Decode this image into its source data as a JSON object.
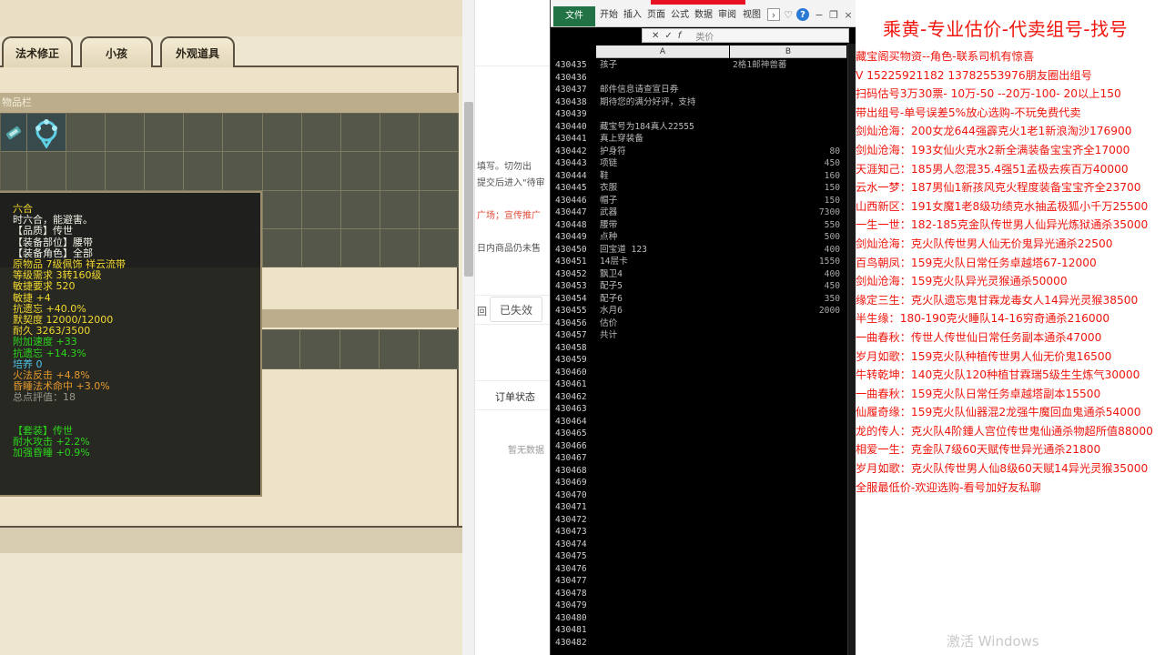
{
  "game": {
    "tabs": [
      "法术修正",
      "小孩",
      "外观道具"
    ],
    "inventory_header": "物品栏",
    "tooltip": {
      "name": "六合",
      "desc": "时六合，能避害。",
      "quality": "【品质】传世",
      "slot": "【装备部位】腰带",
      "role": "【装备角色】全部",
      "origin": "原物品 7级佩饰 祥云流带",
      "level_req": "等级需求 3转160级",
      "agi_req": "敏捷要求 520",
      "agi": "敏捷 +4",
      "resist_forget": "抗遗忘 +40.0%",
      "tacit": "默契度 12000/12000",
      "durability": "耐久 3263/3500",
      "speed": "附加速度 +33",
      "resist_forget2": "抗遗忘 +14.3%",
      "cultivate": "培养 0",
      "fire_counter": "火法反击 +4.8%",
      "sleep_hit": "昏睡法术命中 +3.0%",
      "total": "总点評值：18",
      "set": "【套装】传世",
      "water_atk": "耐水攻击 +2.2%",
      "sleep_boost": "加强昏睡 +0.9%"
    }
  },
  "web": {
    "text1": "填写。切勿出",
    "text2": "提交后进入\"待审",
    "text3": "广场；宣传推广",
    "text4": "日内商品仍未售",
    "col_left": "回",
    "expired_btn": "已失效",
    "order_status": "订单状态",
    "no_data": "暂无数据"
  },
  "excel": {
    "tabs": [
      "文件",
      "开始",
      "插入",
      "页面",
      "公式",
      "数据",
      "审阅",
      "视图"
    ],
    "formula_bar": "类价",
    "col_a": "A",
    "col_b": "B",
    "rows": [
      {
        "num": "430435",
        "a": "孩子",
        "b": "2格1邮神兽蕃",
        "v": ""
      },
      {
        "num": "430436",
        "a": "",
        "b": "",
        "v": ""
      },
      {
        "num": "430437",
        "a": "邮件信息请查宣日券",
        "b": "",
        "v": ""
      },
      {
        "num": "430438",
        "a": "期待您的满分好评，支持",
        "b": "",
        "v": ""
      },
      {
        "num": "430439",
        "a": "",
        "b": "",
        "v": ""
      },
      {
        "num": "430440",
        "a": "藏宝号为184真人22555",
        "b": "",
        "v": ""
      },
      {
        "num": "430441",
        "a": "真上穿装备",
        "b": "",
        "v": ""
      },
      {
        "num": "430442",
        "a": "护身符",
        "b": "",
        "v": "80"
      },
      {
        "num": "430443",
        "a": "项链",
        "b": "",
        "v": "450"
      },
      {
        "num": "430444",
        "a": "鞋",
        "b": "",
        "v": "160"
      },
      {
        "num": "430445",
        "a": "衣服",
        "b": "",
        "v": "150"
      },
      {
        "num": "430446",
        "a": "帽子",
        "b": "",
        "v": "150"
      },
      {
        "num": "430447",
        "a": "武器",
        "b": "",
        "v": "7300"
      },
      {
        "num": "430448",
        "a": "腰带",
        "b": "",
        "v": "550"
      },
      {
        "num": "430449",
        "a": "点种",
        "b": "",
        "v": "500"
      },
      {
        "num": "430450",
        "a": "回宝道 123",
        "b": "",
        "v": "400"
      },
      {
        "num": "430451",
        "a": "14层卡",
        "b": "",
        "v": "1550"
      },
      {
        "num": "430452",
        "a": "飘卫4",
        "b": "",
        "v": "400"
      },
      {
        "num": "430453",
        "a": "配子5",
        "b": "",
        "v": "450"
      },
      {
        "num": "430454",
        "a": "配子6",
        "b": "",
        "v": "350"
      },
      {
        "num": "430455",
        "a": "水月6",
        "b": "",
        "v": "2000"
      },
      {
        "num": "430456",
        "a": "估价",
        "b": "",
        "v": ""
      },
      {
        "num": "430457",
        "a": "共计",
        "b": "",
        "v": ""
      },
      {
        "num": "430458",
        "a": "",
        "b": "",
        "v": ""
      },
      {
        "num": "430459",
        "a": "",
        "b": "",
        "v": ""
      },
      {
        "num": "430460",
        "a": "",
        "b": "",
        "v": ""
      },
      {
        "num": "430461",
        "a": "",
        "b": "",
        "v": ""
      },
      {
        "num": "430462",
        "a": "",
        "b": "",
        "v": ""
      },
      {
        "num": "430463",
        "a": "",
        "b": "",
        "v": ""
      },
      {
        "num": "430464",
        "a": "",
        "b": "",
        "v": ""
      },
      {
        "num": "430465",
        "a": "",
        "b": "",
        "v": ""
      },
      {
        "num": "430466",
        "a": "",
        "b": "",
        "v": ""
      },
      {
        "num": "430467",
        "a": "",
        "b": "",
        "v": ""
      },
      {
        "num": "430468",
        "a": "",
        "b": "",
        "v": ""
      },
      {
        "num": "430469",
        "a": "",
        "b": "",
        "v": ""
      },
      {
        "num": "430470",
        "a": "",
        "b": "",
        "v": ""
      },
      {
        "num": "430471",
        "a": "",
        "b": "",
        "v": ""
      },
      {
        "num": "430472",
        "a": "",
        "b": "",
        "v": ""
      },
      {
        "num": "430473",
        "a": "",
        "b": "",
        "v": ""
      },
      {
        "num": "430474",
        "a": "",
        "b": "",
        "v": ""
      },
      {
        "num": "430475",
        "a": "",
        "b": "",
        "v": ""
      },
      {
        "num": "430476",
        "a": "",
        "b": "",
        "v": ""
      },
      {
        "num": "430477",
        "a": "",
        "b": "",
        "v": ""
      },
      {
        "num": "430478",
        "a": "",
        "b": "",
        "v": ""
      },
      {
        "num": "430479",
        "a": "",
        "b": "",
        "v": ""
      },
      {
        "num": "430480",
        "a": "",
        "b": "",
        "v": ""
      },
      {
        "num": "430481",
        "a": "",
        "b": "",
        "v": ""
      },
      {
        "num": "430482",
        "a": "",
        "b": "",
        "v": ""
      }
    ]
  },
  "ad": {
    "title": "乘黄-专业估价-代卖组号-找号",
    "lines": [
      "藏宝阁买物资--角色-联系司机有惊喜",
      "V 15225921182  13782553976朋友圈出组号",
      "扫码估号3万30票- 10万-50 --20万-100- 20以上150",
      "带出组号-单号误差5%放心选购-不玩免费代卖",
      "剑灿沧海：200女龙644强霹克火1老1新浪淘沙176900",
      "剑灿沧海：193女仙火克水2新全满装备宝宝齐全17000",
      "天涯知己：185男人忽混35.4强51孟极去疾百万40000",
      "云水一梦：187男仙1新孩风克火程度装备宝宝齐全23700",
      "山西新区：191女魔1老8级功绩克水抽孟极狐小千万25500",
      "一生一世：182-185克金队传世男人仙异光炼狱通杀35000",
      "剑灿沧海：克火队传世男人仙无价鬼异光通杀22500",
      "百鸟朝凤：159克火队日常任务卓越塔67-12000",
      "剑灿沧海：159克火队异光灵猴通杀50000",
      "缘定三生：克火队遗忘鬼甘霖龙毒女人14异光灵猴38500",
      "半生缘：180-190克火睡队14-16穷奇通杀216000",
      "一曲春秋：传世人传世仙日常任务副本通杀47000",
      "岁月如歌：159克火队种植传世男人仙无价鬼16500",
      "牛转乾坤：140克火队120种植甘霖瑞5级生生炼气30000",
      "一曲春秋：159克火队日常任务卓越塔副本15500",
      "仙履奇缘：159克火队仙器混2龙强牛魔回血鬼通杀54000",
      "龙的传人：克火队4阶鍾人宫位传世鬼仙通杀物超所值88000",
      "相爱一生：克金队7级60天赋传世异光通杀21800",
      "岁月如歌：克火队传世男人仙8级60天赋14异光灵猴35000",
      "全服最低价-欢迎选购-看号加好友私聊"
    ]
  },
  "watermark": "激活 Windows"
}
